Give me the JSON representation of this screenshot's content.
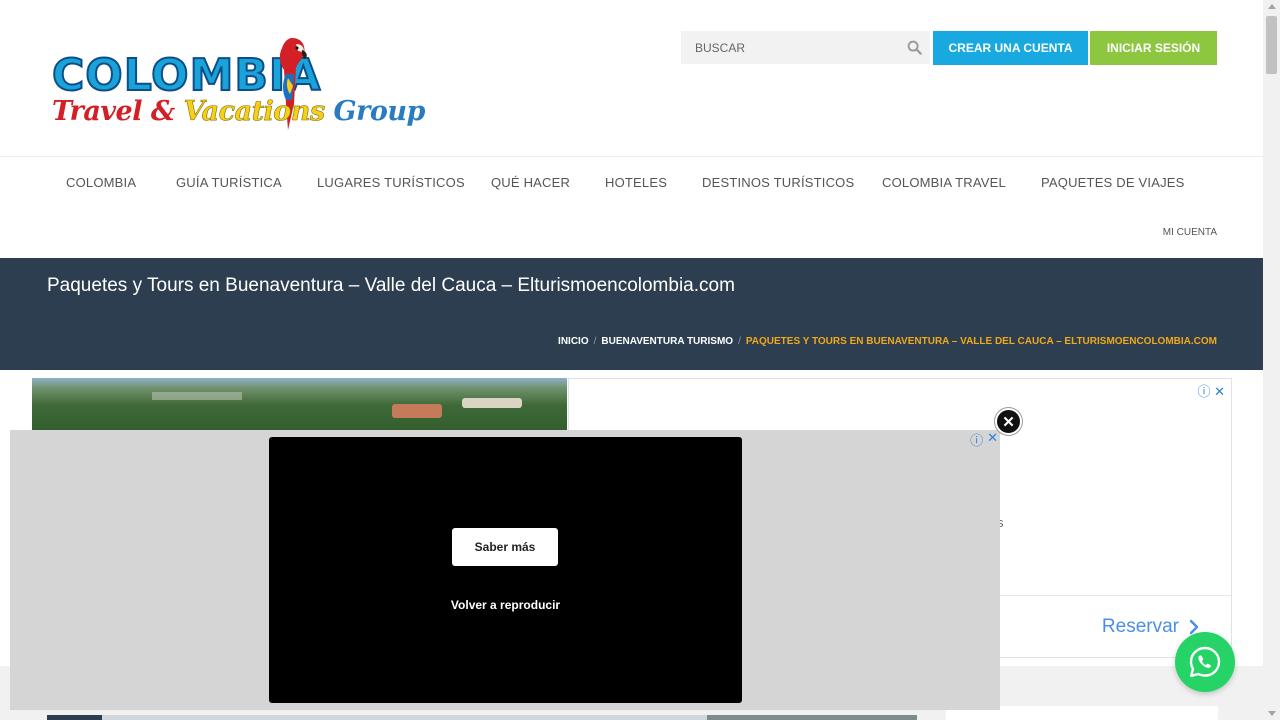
{
  "header": {
    "logo": {
      "word": "COLOMBIA",
      "script_1": "Travel",
      "script_2": " & ",
      "script_3": "Vacations",
      "script_4": " Group"
    },
    "search": {
      "placeholder": "BUSCAR",
      "icon": "search-icon"
    },
    "create_account_label": "CREAR UNA CUENTA",
    "login_label": "INICIAR SESIÓN",
    "colors": {
      "create_account": "#17a9e0",
      "login": "#8dc63f"
    }
  },
  "nav": {
    "items": [
      {
        "label": "COLOMBIA"
      },
      {
        "label": "GUÍA TURÍSTICA"
      },
      {
        "label": "LUGARES TURÍSTICOS"
      },
      {
        "label": "QUÉ HACER"
      },
      {
        "label": "HOTELES"
      },
      {
        "label": "DESTINOS TURÍSTICOS"
      },
      {
        "label": "COLOMBIA TRAVEL"
      },
      {
        "label": "PAQUETES DE VIAJES"
      }
    ],
    "account_label": "MI CUENTA"
  },
  "page_title": {
    "title": "Paquetes y Tours en Buenaventura – Valle del Cauca – Elturismoencolombia.com",
    "breadcrumb": [
      {
        "label": "INICIO"
      },
      {
        "label": "BUENAVENTURA TURISMO"
      },
      {
        "label": "PAQUETES Y TOURS EN BUENAVENTURA – VALLE DEL CAUCA – ELTURISMOENCOLOMBIA.COM"
      }
    ],
    "separator": "/",
    "colors": {
      "bar": "#2c3e50",
      "current_crumb": "#f0a81b"
    }
  },
  "ad": {
    "info_icon": "ⓘ",
    "close_icon": "✕",
    "fragment_text": "s",
    "cta_label": "Reservar",
    "cta_arrow": "›"
  },
  "video_overlay": {
    "learn_more_label": "Saber más",
    "replay_label": "Volver a reproducir",
    "close_symbol": "✕"
  },
  "whatsapp": {
    "icon": "whatsapp-icon",
    "color": "#25d366"
  }
}
